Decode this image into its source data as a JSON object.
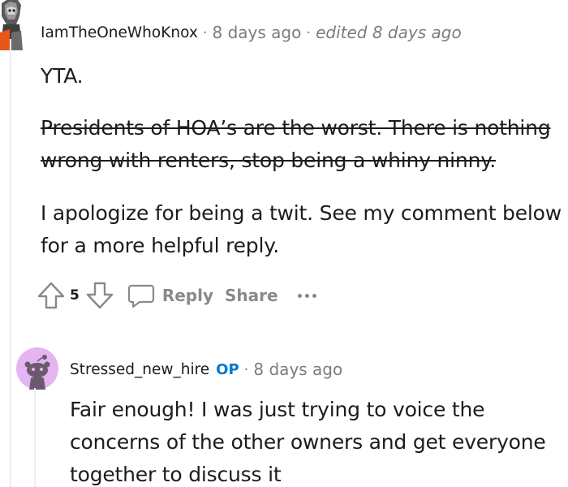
{
  "comment": {
    "username": "IamTheOneWhoKnox",
    "separator": "·",
    "time": "8 days ago",
    "edited": "edited 8 days ago",
    "paragraphs": {
      "p1": "YTA.",
      "p2_struck": "Presidents of HOA’s are the worst. There is nothing wrong with renters, stop being a whiny ninny.",
      "p3": "I apologize for being a twit. See my comment below for a more helpful reply."
    },
    "vote_count": "5",
    "actions": {
      "reply": "Reply",
      "share": "Share"
    }
  },
  "reply": {
    "username": "Stressed_new_hire",
    "op_badge": "OP",
    "separator": "·",
    "time": "8 days ago",
    "body": "Fair enough! I was just trying to voice the concerns of the other owners and get everyone together to discuss it"
  },
  "colors": {
    "accent_op": "#0079d3",
    "muted": "#878a8c",
    "avatar_bg": "#e4b5f2"
  }
}
